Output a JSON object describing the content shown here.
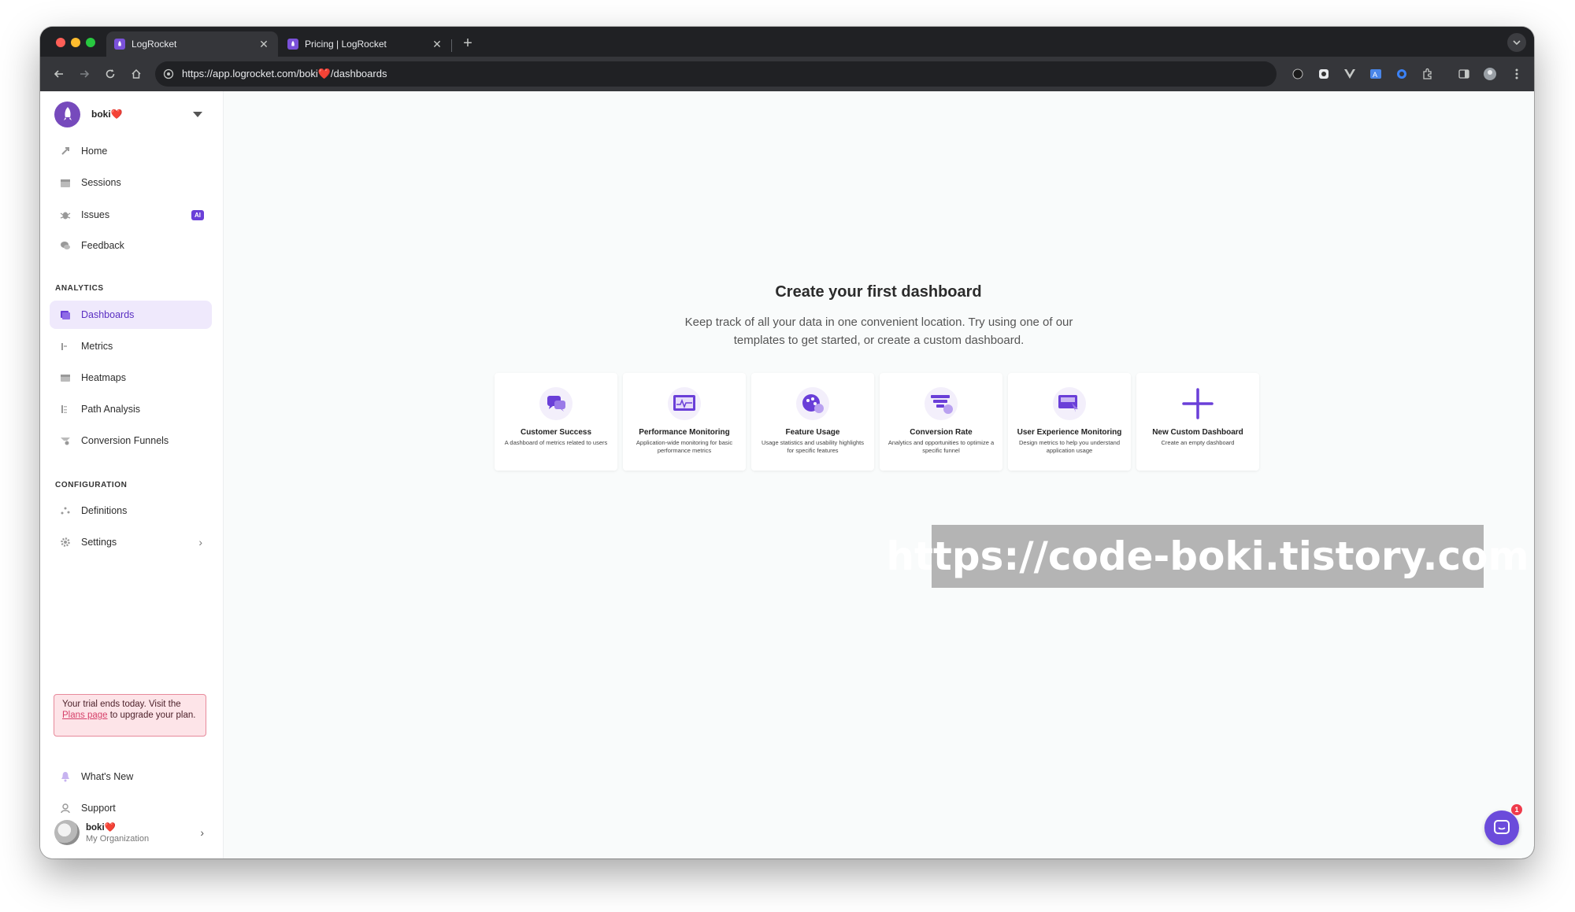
{
  "browser": {
    "tabs": [
      {
        "title": "LogRocket",
        "active": true
      },
      {
        "title": "Pricing | LogRocket",
        "active": false
      }
    ],
    "url": "https://app.logrocket.com/boki❤️/dashboards"
  },
  "sidebar": {
    "org_name": "boki❤️",
    "primary_items": [
      {
        "label": "Home",
        "icon": "rocket-icon"
      },
      {
        "label": "Sessions",
        "icon": "calendar-icon"
      },
      {
        "label": "Issues",
        "icon": "bug-icon",
        "badge": "AI"
      },
      {
        "label": "Feedback",
        "icon": "chat-icon"
      }
    ],
    "analytics_title": "ANALYTICS",
    "analytics_items": [
      {
        "label": "Dashboards",
        "icon": "dashboard-icon",
        "active": true
      },
      {
        "label": "Metrics",
        "icon": "metrics-icon"
      },
      {
        "label": "Heatmaps",
        "icon": "heatmap-icon"
      },
      {
        "label": "Path Analysis",
        "icon": "path-icon"
      },
      {
        "label": "Conversion Funnels",
        "icon": "funnel-icon"
      }
    ],
    "configuration_title": "CONFIGURATION",
    "configuration_items": [
      {
        "label": "Definitions",
        "icon": "definitions-icon"
      },
      {
        "label": "Settings",
        "icon": "gear-icon"
      }
    ],
    "trial": {
      "before": "Your trial ends today. Visit the ",
      "link": "Plans page",
      "after": " to upgrade your plan."
    },
    "bottom_items": [
      {
        "label": "What's New",
        "icon": "bell-icon"
      },
      {
        "label": "Support",
        "icon": "support-icon"
      }
    ],
    "user": {
      "name": "boki❤️",
      "org": "My Organization"
    }
  },
  "main": {
    "title": "Create your first dashboard",
    "subtitle": "Keep track of all your data in one convenient location. Try using one of our templates to get started, or create a custom dashboard.",
    "cards": [
      {
        "title": "Customer Success",
        "desc": "A dashboard of metrics related to users",
        "icon": "customer-success-icon"
      },
      {
        "title": "Performance Monitoring",
        "desc": "Application-wide monitoring for basic performance metrics",
        "icon": "performance-icon"
      },
      {
        "title": "Feature Usage",
        "desc": "Usage statistics and usability highlights for specific features",
        "icon": "feature-usage-icon"
      },
      {
        "title": "Conversion Rate",
        "desc": "Analytics and opportunities to optimize a specific funnel",
        "icon": "conversion-icon"
      },
      {
        "title": "User Experience Monitoring",
        "desc": "Design metrics to help you understand application usage",
        "icon": "ux-icon"
      },
      {
        "title": "New Custom Dashboard",
        "desc": "Create an empty dashboard",
        "icon": "plus-icon"
      }
    ]
  },
  "chat": {
    "badge_count": "1"
  },
  "watermark": "https://code-boki.tistory.com",
  "colors": {
    "accent": "#764abc",
    "active_bg": "#efe9fc",
    "trial_border": "#e78a9b"
  }
}
